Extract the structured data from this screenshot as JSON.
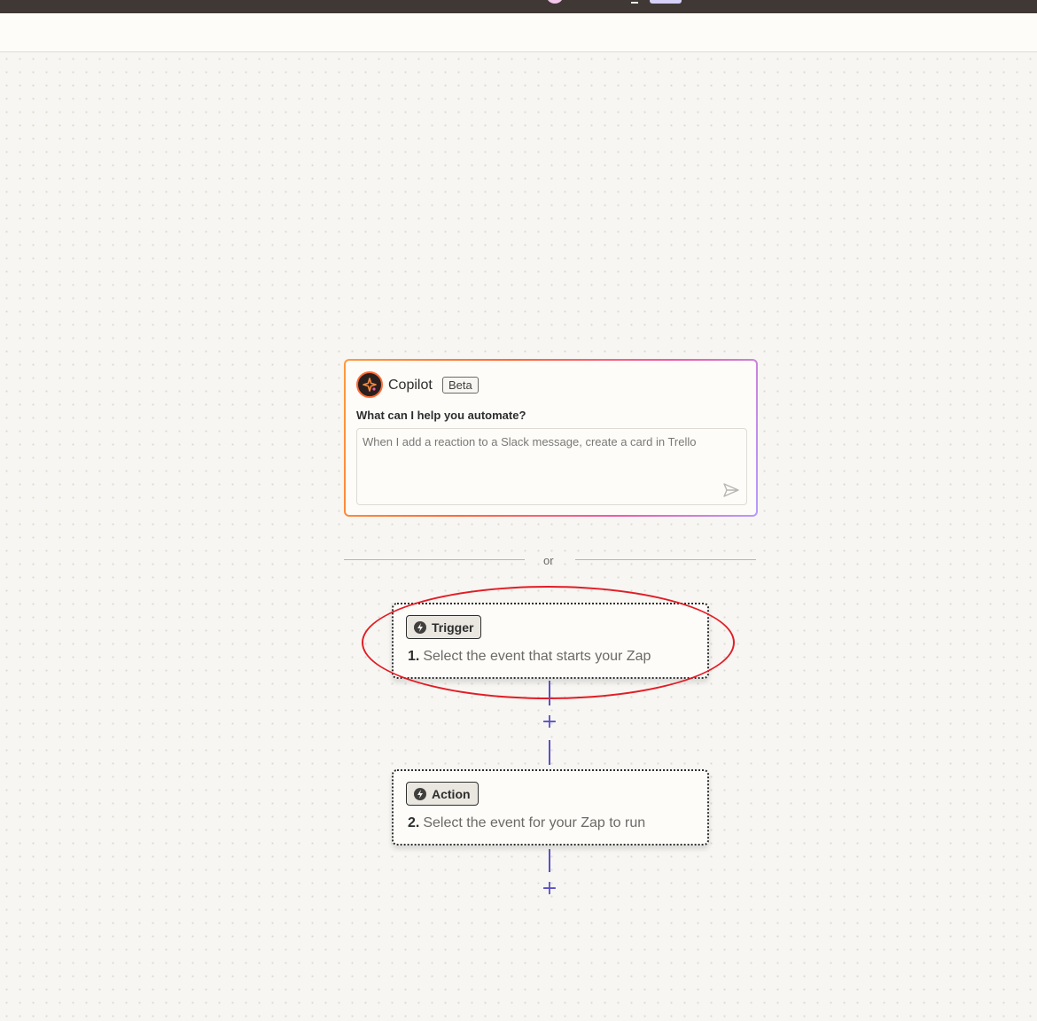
{
  "copilot": {
    "title": "Copilot",
    "badge": "Beta",
    "prompt_label": "What can I help you automate?",
    "prompt_placeholder": "When I add a reaction to a Slack message, create a card in Trello",
    "logo_icon": "sparkle-icon",
    "send_icon": "send-icon"
  },
  "divider": {
    "text": "or"
  },
  "steps": [
    {
      "badge": "Trigger",
      "number": "1.",
      "text": "Select the event that starts your Zap",
      "icon": "lightning-icon"
    },
    {
      "badge": "Action",
      "number": "2.",
      "text": "Select the event for your Zap to run",
      "icon": "lightning-icon"
    }
  ],
  "add_step": {
    "label": "+"
  },
  "colors": {
    "accent": "#5b50c8",
    "highlight": "#e21d26",
    "copilot_gradient_start": "#ff9a3c",
    "copilot_gradient_end": "#b49cff"
  }
}
